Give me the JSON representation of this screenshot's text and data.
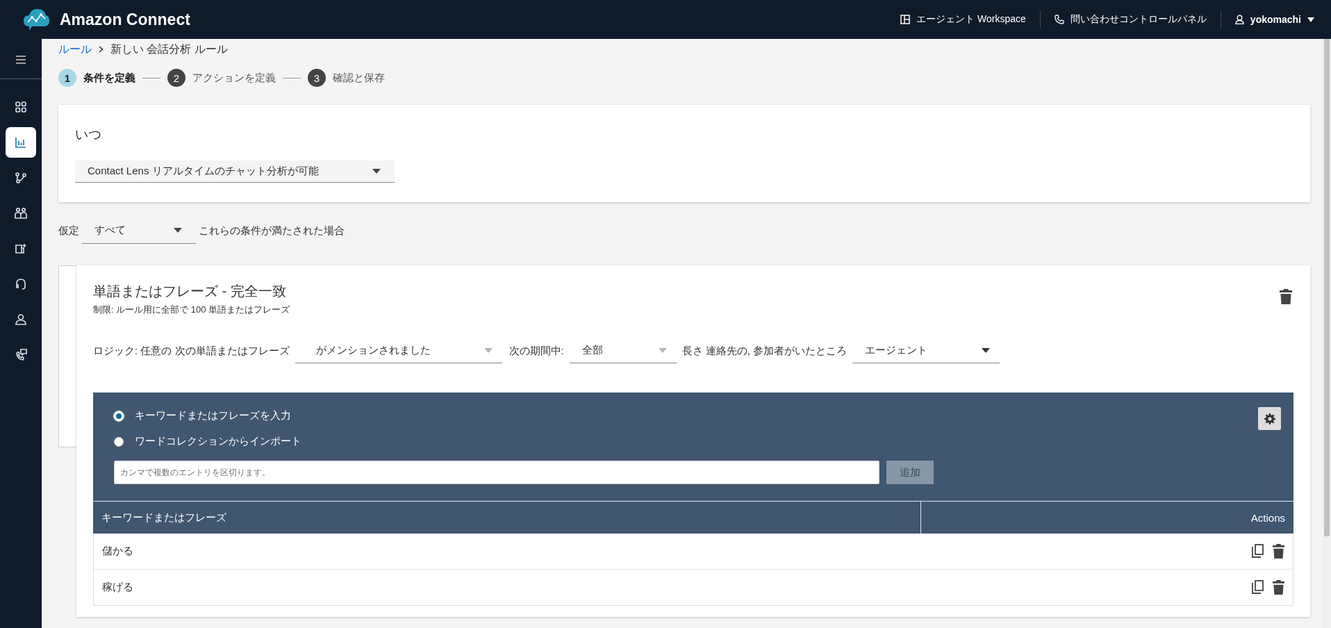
{
  "header": {
    "brand": "Amazon Connect",
    "links": [
      {
        "label": "エージェント Workspace",
        "kind": "workspace"
      },
      {
        "label": "問い合わせコントロールパネル",
        "kind": "phone"
      }
    ],
    "user": "yokomachi"
  },
  "sidebar": {
    "items": [
      {
        "selected": false
      },
      {
        "selected": true
      },
      {
        "selected": false
      },
      {
        "selected": false
      },
      {
        "selected": false
      },
      {
        "selected": false
      },
      {
        "selected": false
      },
      {
        "selected": false
      }
    ]
  },
  "breadcrumb": {
    "link": "ルール",
    "current": "新しい 会話分析 ルール"
  },
  "steps": [
    {
      "number": "1",
      "label": "条件を定義",
      "selected": true
    },
    {
      "number": "2",
      "label": "アクションを定義",
      "selected": false
    },
    {
      "number": "3",
      "label": "確認と保存",
      "selected": false
    }
  ],
  "when_card": {
    "title": "いつ",
    "select": "Contact Lens リアルタイムのチャット分析が可能"
  },
  "assumption": {
    "prefix": "仮定",
    "select": "すべて",
    "suffix": "これらの条件が満たされた場合"
  },
  "condition": {
    "title": "単語またはフレーズ - 完全一致",
    "subtitle": "制限: ルール用に全部で 100 単語またはフレーズ",
    "logic": [
      {
        "kind": "text",
        "text": "ロジック: 任意の 次の単語またはフレーズ"
      },
      {
        "kind": "select",
        "text": "がメンションされました",
        "disabled": true
      },
      {
        "kind": "text",
        "text": "次の期間中:"
      },
      {
        "kind": "select",
        "text": "全部",
        "disabled": true
      },
      {
        "kind": "text",
        "text": "長さ 連絡先の, 参加者がいたところ"
      },
      {
        "kind": "select",
        "text": "エージェント",
        "disabled": false
      }
    ],
    "options": [
      {
        "label": "キーワードまたはフレーズを入力",
        "selected": true
      },
      {
        "label": "ワードコレクションからインポート",
        "selected": false
      }
    ],
    "input": {
      "placeholder": "カンマで複数のエントリを区切ります。"
    },
    "add_button": {
      "label": "追加",
      "disabled": true
    },
    "table": {
      "columns": [
        "キーワードまたはフレーズ",
        "Actions"
      ],
      "rows": [
        {
          "phrase": "儲かる"
        },
        {
          "phrase": "稼げる"
        }
      ]
    }
  }
}
